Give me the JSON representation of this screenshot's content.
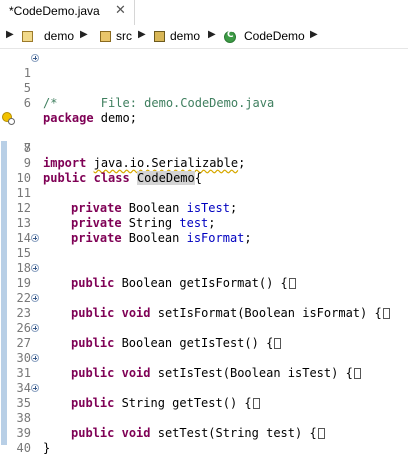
{
  "tab": {
    "title": "*CodeDemo.java",
    "close": "✕",
    "icon": "java-file-icon"
  },
  "breadcrumb": {
    "items": [
      {
        "label": "demo",
        "icon": "project-icon"
      },
      {
        "label": "src",
        "icon": "source-folder-icon"
      },
      {
        "label": "demo",
        "icon": "package-icon"
      },
      {
        "label": "CodeDemo",
        "icon": "class-icon"
      }
    ],
    "arrow": "▶"
  },
  "editor": {
    "lines": [
      {
        "n": "1",
        "text": "/*      File: demo.CodeDemo.java"
      },
      {
        "n": "5",
        "text": ""
      },
      {
        "n": "6",
        "text": "package demo;"
      },
      {
        "n": "7",
        "text": "import java.io.Serializable;"
      },
      {
        "n": "8",
        "text": ""
      },
      {
        "n": "9",
        "text": "public class CodeDemo{"
      },
      {
        "n": "10",
        "text": ""
      },
      {
        "n": "11",
        "text": "private Boolean isTest;"
      },
      {
        "n": "12",
        "text": "private String test;"
      },
      {
        "n": "13",
        "text": "private Boolean isFormat;"
      },
      {
        "n": "14",
        "text": ""
      },
      {
        "n": "15",
        "text": "public Boolean getIsFormat() {"
      },
      {
        "n": "18",
        "text": ""
      },
      {
        "n": "19",
        "text": "public void setIsFormat(Boolean isFormat) {"
      },
      {
        "n": "22",
        "text": ""
      },
      {
        "n": "23",
        "text": "public Boolean getIsTest() {"
      },
      {
        "n": "26",
        "text": ""
      },
      {
        "n": "27",
        "text": "public void setIsTest(Boolean isTest) {"
      },
      {
        "n": "30",
        "text": ""
      },
      {
        "n": "31",
        "text": "public String getTest() {"
      },
      {
        "n": "34",
        "text": ""
      },
      {
        "n": "35",
        "text": "public void setTest(String test) {"
      },
      {
        "n": "38",
        "text": ""
      },
      {
        "n": "39",
        "text": "}"
      },
      {
        "n": "40",
        "text": ""
      }
    ]
  },
  "colors": {
    "keyword": "#7f0055",
    "comment": "#3f7f5f",
    "field": "#0000c0",
    "line_number": "#787878",
    "ruler": "#b8cfe6"
  }
}
